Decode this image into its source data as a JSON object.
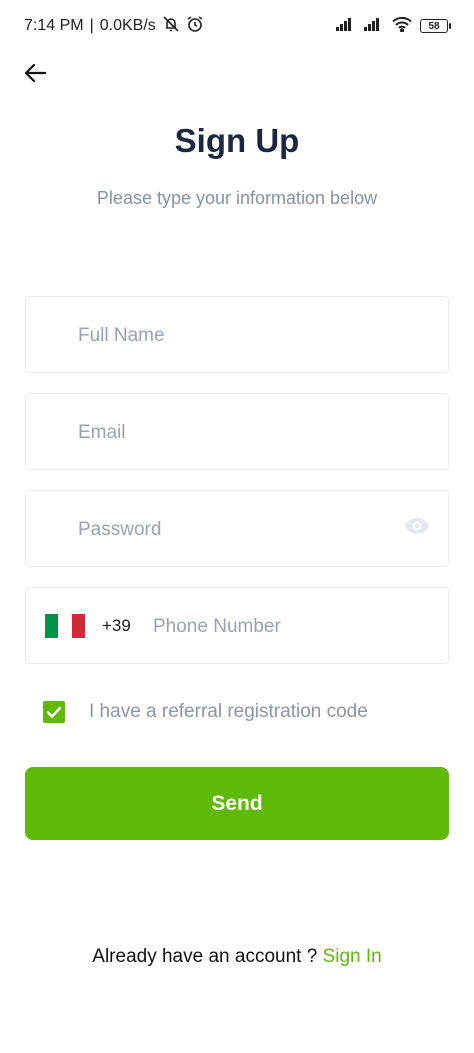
{
  "status_bar": {
    "time": "7:14 PM",
    "separator": "|",
    "speed": "0.0KB/s",
    "battery": "58",
    "icons": [
      "bell-off-icon",
      "alarm-icon",
      "signal-icon",
      "wifi-icon",
      "battery-icon"
    ]
  },
  "header": {
    "back_icon": "arrow-left-icon",
    "title": "Sign Up",
    "subtitle": "Please type your information below"
  },
  "form": {
    "full_name": {
      "placeholder": "Full Name",
      "value": ""
    },
    "email": {
      "placeholder": "Email",
      "value": ""
    },
    "password": {
      "placeholder": "Password",
      "value": "",
      "toggle_icon": "eye-icon"
    },
    "phone": {
      "country_flag": "italy-flag-icon",
      "flag_colors": [
        "#009246",
        "#ffffff",
        "#ce2b37"
      ],
      "dial_code": "+39",
      "placeholder": "Phone Number",
      "value": ""
    },
    "referral": {
      "checked": true,
      "label": "I have a referral registration code"
    },
    "send_label": "Send"
  },
  "footer": {
    "prompt": "Already have an account ?",
    "link": "Sign In"
  },
  "colors": {
    "accent": "#5fba08",
    "title": "#1b2740",
    "muted": "#8593a6",
    "border": "#e8ecf1"
  }
}
